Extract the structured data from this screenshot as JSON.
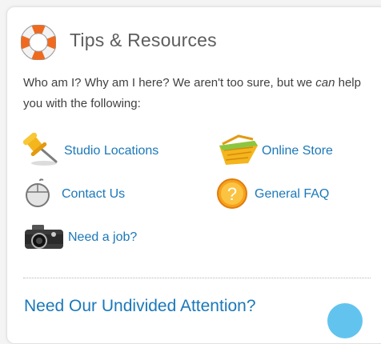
{
  "panel": {
    "title": "Tips & Resources",
    "title_icon": "life-ring-icon",
    "intro_before": "Who am I? Why am I here? We aren't too sure, but we ",
    "intro_emphasis": "can",
    "intro_after": " help you with the following:"
  },
  "links": {
    "studio_locations": {
      "label": "Studio Locations",
      "icon": "pushpin-icon"
    },
    "online_store": {
      "label": "Online Store",
      "icon": "shopping-basket-icon"
    },
    "contact_us": {
      "label": "Contact Us",
      "icon": "computer-mouse-icon"
    },
    "general_faq": {
      "label": "General FAQ",
      "icon": "question-mark-icon"
    },
    "need_a_job": {
      "label": "Need a job?",
      "icon": "camera-icon"
    }
  },
  "next_section": {
    "title": "Need Our Undivided Attention?"
  },
  "colors": {
    "link": "#1b78b9",
    "title": "#5d5d5d",
    "text": "#404040",
    "accent_orange": "#f07c1a",
    "bubble": "#62c4ee"
  }
}
